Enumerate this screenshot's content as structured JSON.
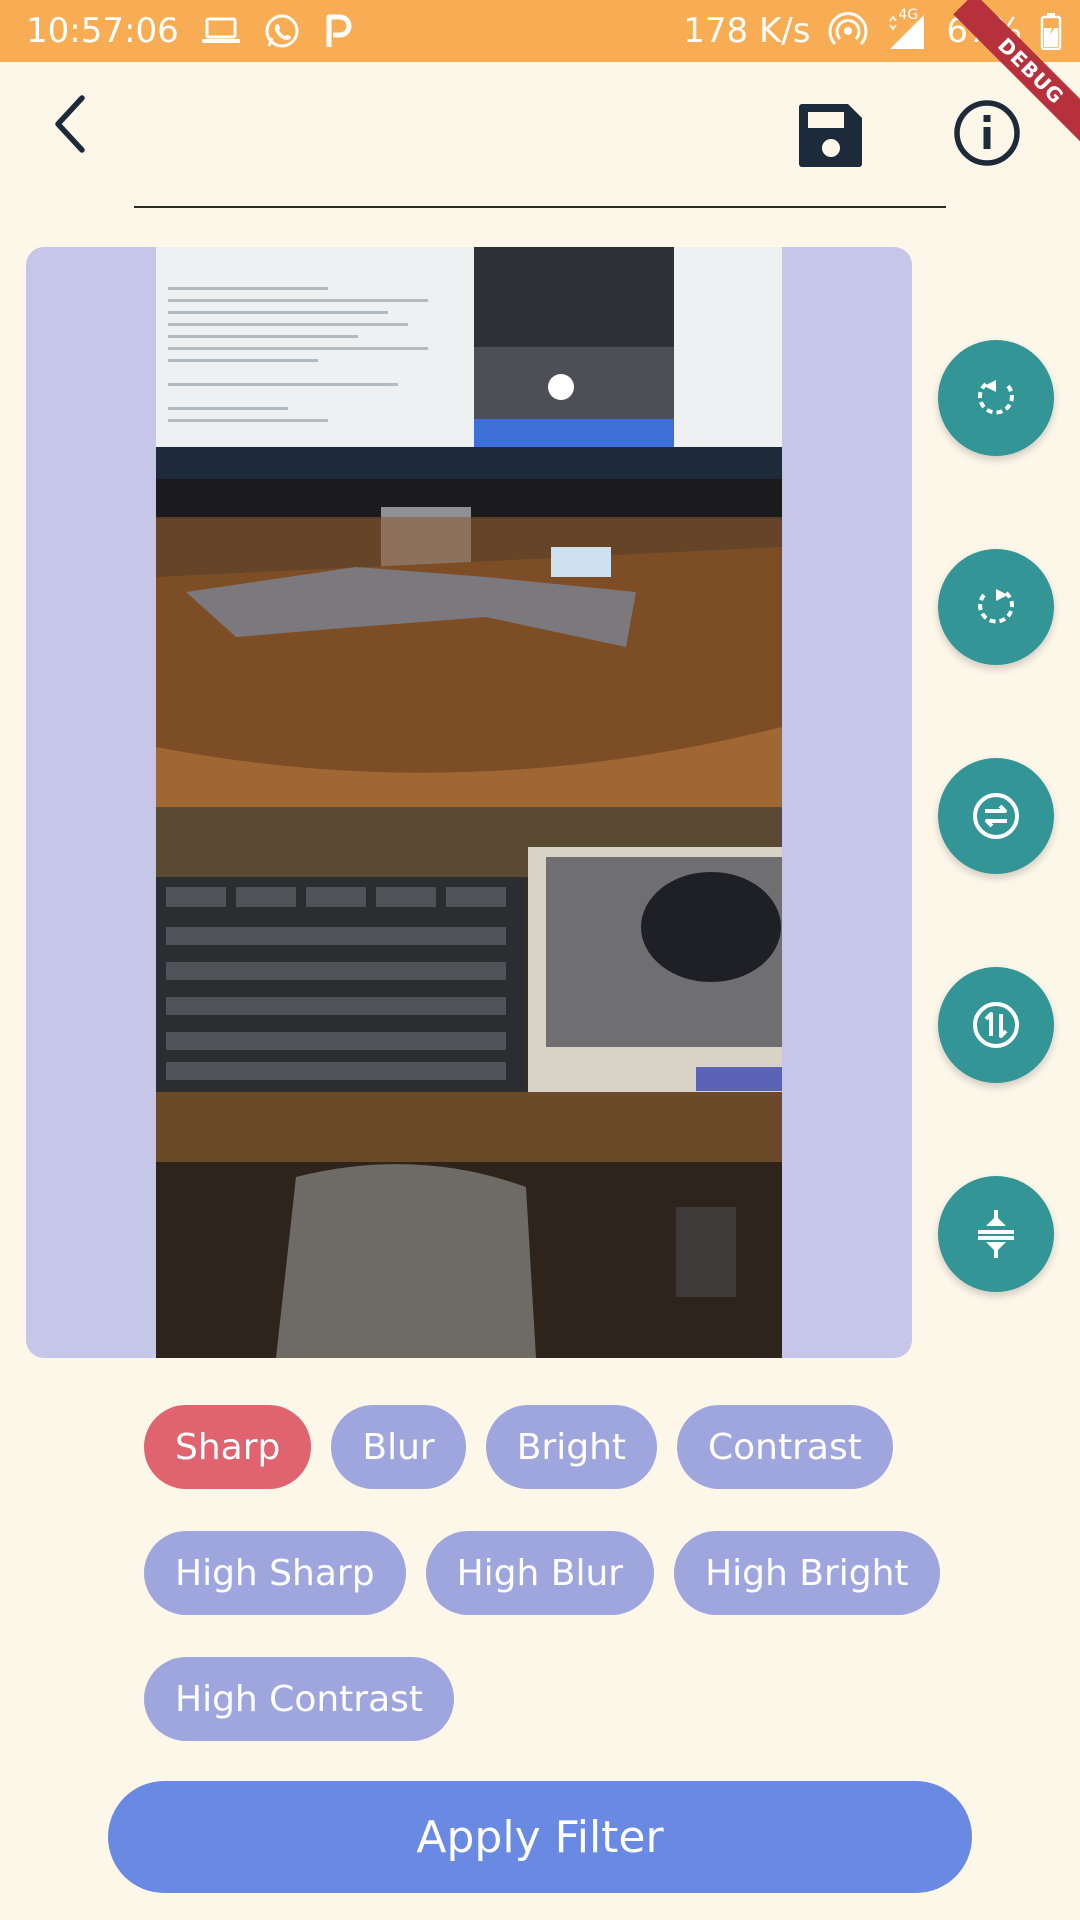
{
  "status_bar": {
    "time": "10:57:06",
    "net_speed": "178 K/s",
    "network_type": "4G",
    "battery": "67%",
    "left_icons": [
      "laptop-icon",
      "whatsapp-icon",
      "p-app-icon"
    ],
    "right_icons": [
      "hotspot-icon",
      "signal-icon",
      "battery-icon"
    ]
  },
  "debug_banner": "DEBUG",
  "app_bar": {
    "back_icon": "chevron-left-icon",
    "actions": [
      "save-icon",
      "info-icon"
    ]
  },
  "tools": [
    {
      "name": "rotate-left-icon"
    },
    {
      "name": "rotate-right-icon"
    },
    {
      "name": "flip-horizontal-icon"
    },
    {
      "name": "flip-vertical-icon"
    },
    {
      "name": "compress-icon"
    }
  ],
  "filters": {
    "selected": "Sharp",
    "rows": [
      [
        "Sharp",
        "Blur",
        "Bright",
        "Contrast"
      ],
      [
        "High Sharp",
        "High Blur",
        "High Bright"
      ],
      [
        "High Contrast"
      ]
    ]
  },
  "apply_button": "Apply Filter",
  "colors": {
    "status_bar": "#f8ad55",
    "background": "#fdf7ea",
    "image_frame": "#c5c6e8",
    "tool_button": "#339596",
    "chip": "#9fa6dd",
    "chip_selected": "#e06470",
    "apply_button": "#6a89e3"
  }
}
